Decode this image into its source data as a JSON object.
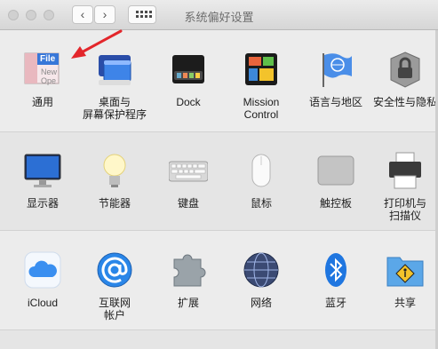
{
  "window": {
    "title": "系统偏好设置",
    "back": "‹",
    "forward": "›"
  },
  "rows": [
    [
      {
        "id": "general",
        "label": "通用",
        "icon": "general-icon",
        "badge": "File",
        "badge_lines": [
          "New",
          "Ope"
        ]
      },
      {
        "id": "desktop",
        "label": "桌面与\n屏幕保护程序",
        "icon": "desktop-screensaver-icon"
      },
      {
        "id": "dock",
        "label": "Dock",
        "icon": "dock-icon"
      },
      {
        "id": "mission",
        "label": "Mission\nControl",
        "icon": "mission-control-icon"
      },
      {
        "id": "language",
        "label": "语言与地区",
        "icon": "language-region-icon"
      },
      {
        "id": "security",
        "label": "安全性与隐私",
        "icon": "security-privacy-icon"
      }
    ],
    [
      {
        "id": "displays",
        "label": "显示器",
        "icon": "displays-icon"
      },
      {
        "id": "energy",
        "label": "节能器",
        "icon": "energy-saver-icon"
      },
      {
        "id": "keyboard",
        "label": "键盘",
        "icon": "keyboard-icon"
      },
      {
        "id": "mouse",
        "label": "鼠标",
        "icon": "mouse-icon"
      },
      {
        "id": "trackpad",
        "label": "触控板",
        "icon": "trackpad-icon"
      },
      {
        "id": "printers",
        "label": "打印机与\n扫描仪",
        "icon": "printer-scanner-icon"
      }
    ],
    [
      {
        "id": "icloud",
        "label": "iCloud",
        "icon": "icloud-icon"
      },
      {
        "id": "internet",
        "label": "互联网\n帐户",
        "icon": "internet-accounts-icon"
      },
      {
        "id": "extensions",
        "label": "扩展",
        "icon": "extensions-icon"
      },
      {
        "id": "network",
        "label": "网络",
        "icon": "network-icon"
      },
      {
        "id": "bluetooth",
        "label": "蓝牙",
        "icon": "bluetooth-icon"
      },
      {
        "id": "sharing",
        "label": "共享",
        "icon": "sharing-icon"
      }
    ]
  ],
  "colors": {
    "arrow": "#e3262b",
    "accent": "#1f7ae6"
  }
}
